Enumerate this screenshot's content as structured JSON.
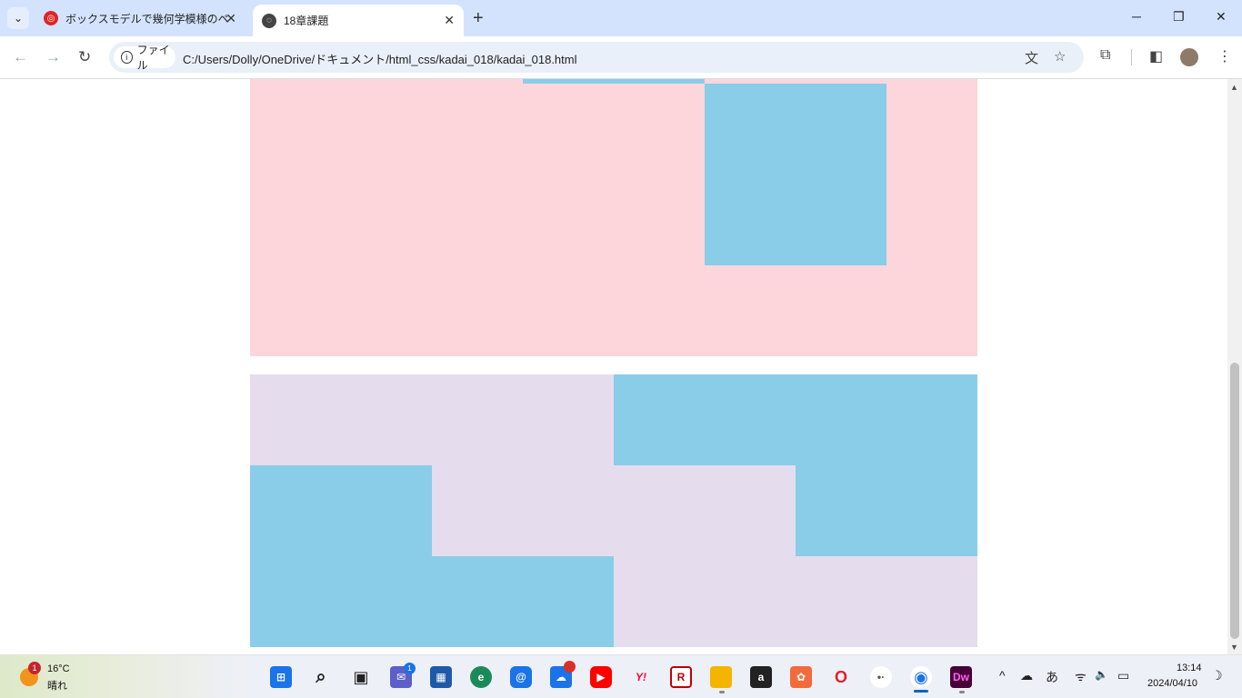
{
  "tabs": [
    {
      "title": "ボックスモデルで幾何学模様のペー",
      "close": "✕"
    },
    {
      "title": "18章課題",
      "close": "✕"
    }
  ],
  "tab_list_glyph": "⌄",
  "new_tab_glyph": "+",
  "window_controls": {
    "minimize": "─",
    "restore": "❐",
    "close": "✕"
  },
  "nav": {
    "back": "←",
    "forward": "→",
    "reload": "↻"
  },
  "address_bar": {
    "chip_label": "ファイル",
    "url": "C:/Users/Dolly/OneDrive/ドキュメント/html_css/kadai_018/kadai_018.html"
  },
  "toolbar_icons": [
    "translate-icon",
    "star-icon",
    "extensions-icon",
    "side-panel-icon",
    "profile-avatar",
    "menu-icon"
  ],
  "page": {
    "box_colors": {
      "pink": "#fdd6dc",
      "lavender": "#e5dcee",
      "blue": "#89cde9"
    }
  },
  "taskbar": {
    "weather": {
      "temp": "16°C",
      "desc": "晴れ",
      "badge": "1"
    },
    "apps": [
      {
        "name": "start",
        "glyph": "⊞",
        "color": "#1a73e8"
      },
      {
        "name": "search",
        "glyph": "⌕",
        "color": "#333"
      },
      {
        "name": "task-view",
        "glyph": "▣",
        "color": "#333"
      },
      {
        "name": "teams",
        "glyph": "✉",
        "color": "#5b5fc7",
        "badge": "1"
      },
      {
        "name": "store",
        "glyph": "▦",
        "color": "#1e5aa8"
      },
      {
        "name": "edge",
        "glyph": "e",
        "color": "#1b8a5a"
      },
      {
        "name": "mail",
        "glyph": "@",
        "color": "#1a73e8"
      },
      {
        "name": "onedrive-photos",
        "glyph": "☁",
        "color": "#1a73e8"
      },
      {
        "name": "youtube",
        "glyph": "▶",
        "color": "#ff0000"
      },
      {
        "name": "yahoo",
        "glyph": "Y!",
        "color": "#ff0033"
      },
      {
        "name": "rakuten",
        "glyph": "R",
        "color": "#bf0000"
      },
      {
        "name": "file-explorer",
        "glyph": "▬",
        "color": "#f4b400"
      },
      {
        "name": "amazon",
        "glyph": "a",
        "color": "#222"
      },
      {
        "name": "app-orange",
        "glyph": "✿",
        "color": "#f26b3a"
      },
      {
        "name": "opera",
        "glyph": "O",
        "color": "#e0202c"
      },
      {
        "name": "app-dots",
        "glyph": "•·",
        "color": "#555"
      },
      {
        "name": "chrome",
        "glyph": "◉",
        "color": "#1a73e8"
      },
      {
        "name": "dreamweaver",
        "glyph": "Dw",
        "color": "#470137"
      }
    ],
    "tray": {
      "chevron": "^",
      "cloud": "☁",
      "ime": "あ",
      "wifi": "ᯤ",
      "volume": "🔈",
      "battery": "▭",
      "moon": "☽"
    },
    "clock": {
      "time": "13:14",
      "date": "2024/04/10"
    }
  }
}
